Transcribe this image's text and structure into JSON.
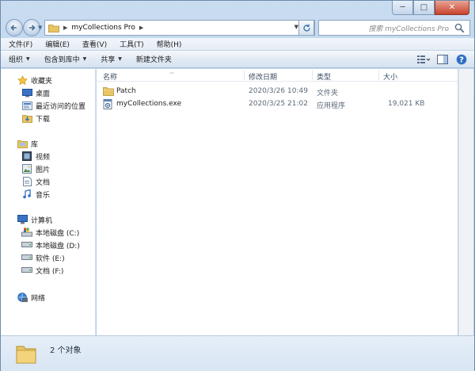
{
  "window": {
    "controls": {
      "minimize": "─",
      "maximize": "□",
      "close": "✕"
    }
  },
  "address": {
    "breadcrumb": "myCollections Pro",
    "search_placeholder": "搜索 myCollections Pro"
  },
  "menu": [
    "文件(F)",
    "编辑(E)",
    "查看(V)",
    "工具(T)",
    "帮助(H)"
  ],
  "toolbar": {
    "organize": "组织",
    "include_in_library": "包含到库中",
    "share": "共享",
    "new_folder": "新建文件夹"
  },
  "nav": {
    "favorites": "收藏夹",
    "desktop": "桌面",
    "recent": "最近访问的位置",
    "downloads": "下载",
    "libraries": "库",
    "videos": "视频",
    "pictures": "图片",
    "documents": "文档",
    "music": "音乐",
    "computer": "计算机",
    "drive_c": "本地磁盘 (C:)",
    "drive_d": "本地磁盘 (D:)",
    "drive_e": "软件 (E:)",
    "drive_f": "文档 (F:)",
    "network": "网络"
  },
  "columns": {
    "name": "名称",
    "modified": "修改日期",
    "type": "类型",
    "size": "大小"
  },
  "files": [
    {
      "name": "Patch",
      "modified": "2020/3/26 10:49",
      "type": "文件夹",
      "size": "",
      "icon": "folder-icon"
    },
    {
      "name": "myCollections.exe",
      "modified": "2020/3/25 21:02",
      "type": "应用程序",
      "size": "19,021 KB",
      "icon": "exe-icon"
    }
  ],
  "details": {
    "summary": "2 个对象"
  }
}
